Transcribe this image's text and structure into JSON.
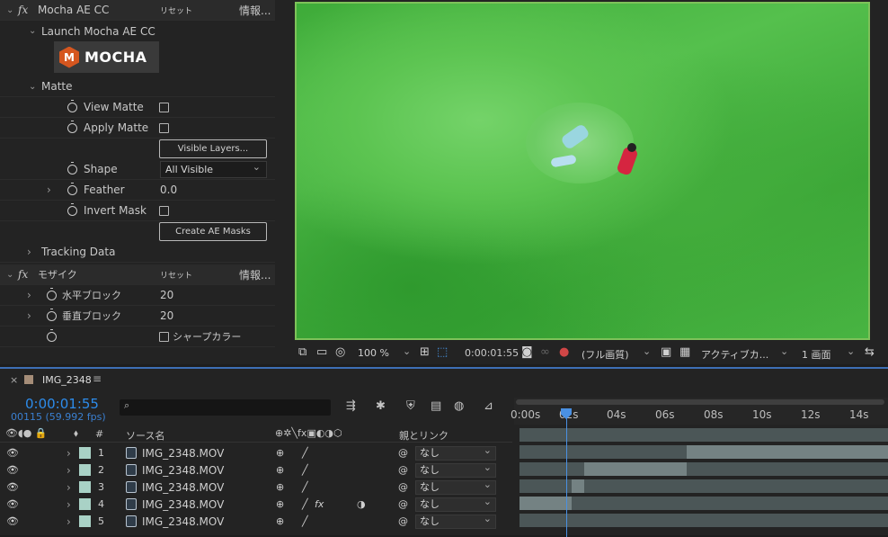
{
  "effect_controls": {
    "mocha": {
      "name": "Mocha AE CC",
      "reset": "リセット",
      "info": "情報...",
      "launch": "Launch Mocha AE CC",
      "logo_text": "MOCHA",
      "matte_group": "Matte",
      "view_matte": "View Matte",
      "apply_matte": "Apply Matte",
      "visible_layers_button": "Visible Layers...",
      "shape_label": "Shape",
      "shape_value": "All Visible",
      "feather_label": "Feather",
      "feather_value": "0.0",
      "invert_mask": "Invert Mask",
      "create_masks_button": "Create AE Masks",
      "tracking_data": "Tracking Data"
    },
    "mosaic": {
      "name": "モザイク",
      "reset": "リセット",
      "info": "情報...",
      "h_blocks_label": "水平ブロック",
      "h_blocks_value": "20",
      "v_blocks_label": "垂直ブロック",
      "v_blocks_value": "20",
      "sharp_color": "シャープカラー"
    }
  },
  "viewer": {
    "zoom": "100 %",
    "timecode": "0:00:01:55",
    "quality": "(フル画質)",
    "camera": "アクティブカ...",
    "views": "1 画面"
  },
  "timeline": {
    "comp_name": "IMG_2348",
    "timecode": "0:00:01:55",
    "frame_info": "00115 (59.992 fps)",
    "search_placeholder": "",
    "col_hash": "#",
    "col_source": "ソース名",
    "col_parent": "親とリンク",
    "ruler_labels": [
      "0:00s",
      "02s",
      "04s",
      "06s",
      "08s",
      "10s",
      "12s",
      "14s"
    ],
    "layers": [
      {
        "num": "1",
        "name": "IMG_2348.MOV",
        "parent": "なし",
        "has_fx": false
      },
      {
        "num": "2",
        "name": "IMG_2348.MOV",
        "parent": "なし",
        "has_fx": false
      },
      {
        "num": "3",
        "name": "IMG_2348.MOV",
        "parent": "なし",
        "has_fx": false
      },
      {
        "num": "4",
        "name": "IMG_2348.MOV",
        "parent": "なし",
        "has_fx": true
      },
      {
        "num": "5",
        "name": "IMG_2348.MOV",
        "parent": "なし",
        "has_fx": false
      }
    ]
  },
  "colors": {
    "accent": "#2d8ceb",
    "frame_border": "#7ec25a",
    "label_swatch": "#a9d2c6"
  }
}
